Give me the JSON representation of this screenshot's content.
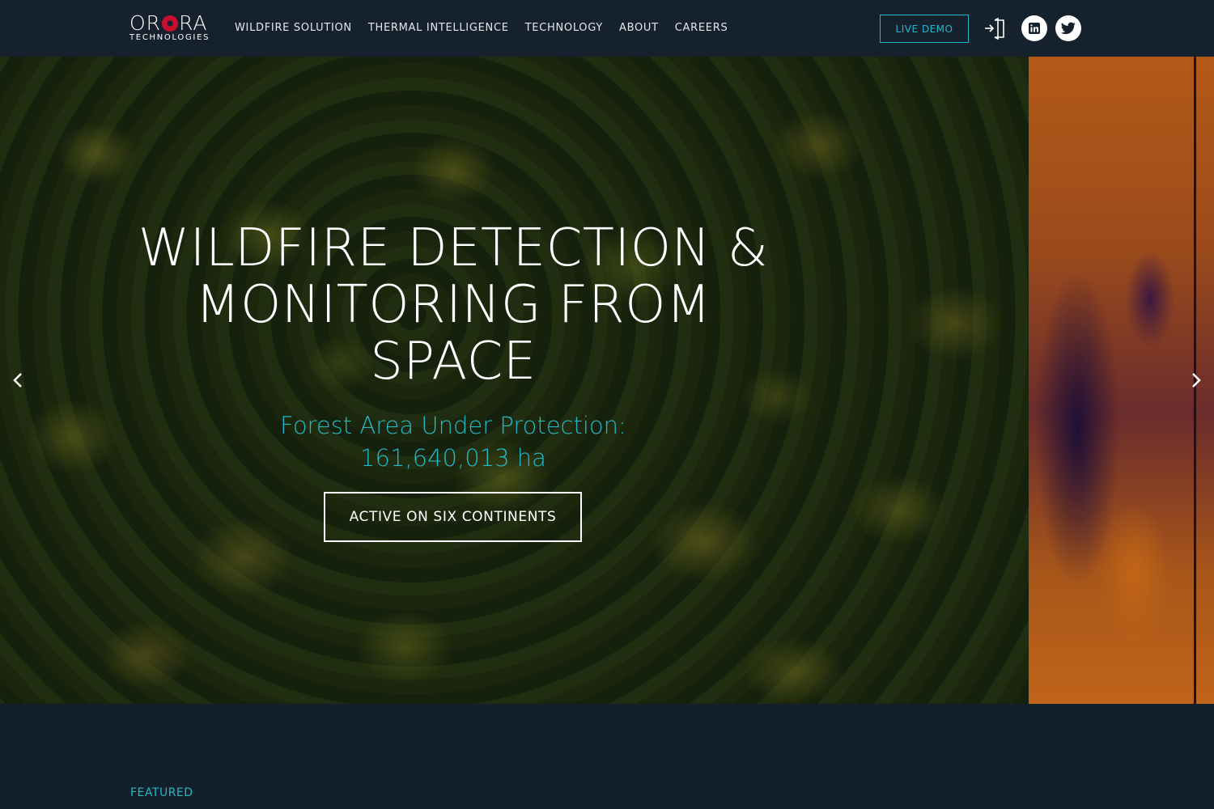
{
  "brand": {
    "logo_text_start": "OR",
    "logo_text_end": "RA",
    "logo_subtitle": "TECHNOLOGIES"
  },
  "nav": {
    "items": [
      {
        "label": "WILDFIRE SOLUTION"
      },
      {
        "label": "THERMAL INTELLIGENCE"
      },
      {
        "label": "TECHNOLOGY"
      },
      {
        "label": "ABOUT"
      },
      {
        "label": "CAREERS"
      }
    ],
    "live_demo_label": "LIVE DEMO",
    "icons": [
      "login-icon",
      "linkedin-icon",
      "twitter-icon"
    ]
  },
  "hero": {
    "title": "WILDFIRE DETECTION & MONITORING FROM SPACE",
    "subtitle_line1": "Forest Area Under Protection:",
    "subtitle_line2": "161,640,013 ha",
    "cta_label": "ACTIVE ON SIX CONTINENTS"
  },
  "section": {
    "featured_label": "FEATURED"
  },
  "colors": {
    "accent": "#23b8c8",
    "background": "#131f2b",
    "navbar": "#15212d",
    "logo_red": "#c8102e"
  }
}
